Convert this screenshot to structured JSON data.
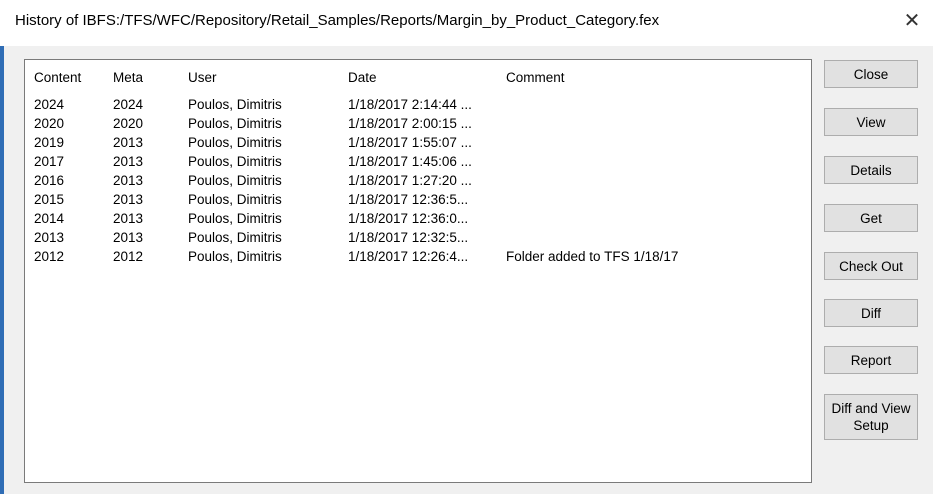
{
  "dialog": {
    "title": "History of IBFS:/TFS/WFC/Repository/Retail_Samples/Reports/Margin_by_Product_Category.fex",
    "close_glyph": "✕"
  },
  "table": {
    "columns": [
      "Content",
      "Meta",
      "User",
      "Date",
      "Comment"
    ],
    "rows": [
      {
        "content": "2024",
        "meta": "2024",
        "user": "Poulos, Dimitris",
        "date": "1/18/2017 2:14:44 ...",
        "comment": ""
      },
      {
        "content": "2020",
        "meta": "2020",
        "user": "Poulos, Dimitris",
        "date": "1/18/2017 2:00:15 ...",
        "comment": ""
      },
      {
        "content": "2019",
        "meta": "2013",
        "user": "Poulos, Dimitris",
        "date": "1/18/2017 1:55:07 ...",
        "comment": ""
      },
      {
        "content": "2017",
        "meta": "2013",
        "user": "Poulos, Dimitris",
        "date": "1/18/2017 1:45:06 ...",
        "comment": ""
      },
      {
        "content": "2016",
        "meta": "2013",
        "user": "Poulos, Dimitris",
        "date": "1/18/2017 1:27:20 ...",
        "comment": ""
      },
      {
        "content": "2015",
        "meta": "2013",
        "user": "Poulos, Dimitris",
        "date": "1/18/2017 12:36:5...",
        "comment": ""
      },
      {
        "content": "2014",
        "meta": "2013",
        "user": "Poulos, Dimitris",
        "date": "1/18/2017 12:36:0...",
        "comment": ""
      },
      {
        "content": "2013",
        "meta": "2013",
        "user": "Poulos, Dimitris",
        "date": "1/18/2017 12:32:5...",
        "comment": ""
      },
      {
        "content": "2012",
        "meta": "2012",
        "user": "Poulos, Dimitris",
        "date": "1/18/2017 12:26:4...",
        "comment": "Folder added to TFS 1/18/17"
      }
    ]
  },
  "buttons": {
    "close": "Close",
    "view": "View",
    "details": "Details",
    "get": "Get",
    "check_out": "Check Out",
    "diff": "Diff",
    "report": "Report",
    "diff_view_setup_line1": "Diff and View",
    "diff_view_setup_line2": "Setup"
  },
  "colors": {
    "window_border_accent": "#2f6db5",
    "dialog_bg": "#f0f0f0",
    "button_bg": "#e1e1e1"
  }
}
